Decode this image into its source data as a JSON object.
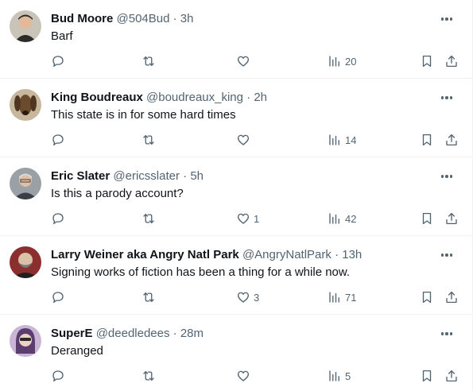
{
  "tweets": [
    {
      "name": "Bud Moore",
      "handle": "@504Bud",
      "separator": "·",
      "time": "3h",
      "text": "Barf",
      "likes": "",
      "views": "20",
      "avatar_bg": "#c9c3b8",
      "avatar_fg": "#2b2b2b"
    },
    {
      "name": "King Boudreaux",
      "handle": "@boudreaux_king",
      "separator": "·",
      "time": "2h",
      "text": "This state is in for some hard times",
      "likes": "",
      "views": "14",
      "avatar_bg": "#c7b79c",
      "avatar_fg": "#6a4b2d"
    },
    {
      "name": "Eric Slater",
      "handle": "@ericsslater",
      "separator": "·",
      "time": "5h",
      "text": "Is this a parody account?",
      "likes": "1",
      "views": "42",
      "avatar_bg": "#9aa0a6",
      "avatar_fg": "#3a3f44"
    },
    {
      "name": "Larry Weiner aka Angry Natl Park",
      "handle": "@AngryNatlPark",
      "separator": "·",
      "time": "13h",
      "text": "Signing works of fiction has been a thing for a while now.",
      "likes": "3",
      "views": "71",
      "avatar_bg": "#8a2e2e",
      "avatar_fg": "#d9c2a8"
    },
    {
      "name": "SuperE",
      "handle": "@deedledees",
      "separator": "·",
      "time": "28m",
      "text": "Deranged",
      "likes": "",
      "views": "5",
      "avatar_bg": "#c9b6d6",
      "avatar_fg": "#5b3d6e"
    }
  ],
  "icons": {
    "reply": "reply-icon",
    "retweet": "retweet-icon",
    "like": "like-icon",
    "views": "views-icon",
    "bookmark": "bookmark-icon",
    "share": "share-icon",
    "more": "more-icon"
  },
  "colors": {
    "text": "#0f1419",
    "secondary": "#536471",
    "divider": "#eff3f4"
  }
}
